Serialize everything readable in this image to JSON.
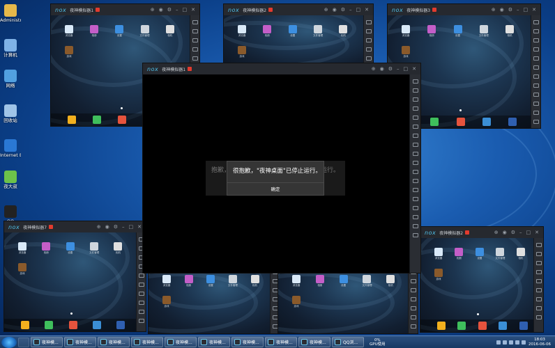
{
  "desktop": {
    "icons": [
      {
        "label": "Administr...",
        "icon": "user-folder-icon",
        "color": "#e6b84a"
      },
      {
        "label": "计算机",
        "icon": "computer-icon",
        "color": "#7fb2e6"
      },
      {
        "label": "网络",
        "icon": "network-icon",
        "color": "#52a0e0"
      },
      {
        "label": "回收站",
        "icon": "recycle-bin-icon",
        "color": "#9fc4e8"
      },
      {
        "label": "Internet Explorer",
        "icon": "internet-explorer-icon",
        "color": "#2a78d4"
      },
      {
        "label": "夜大叔",
        "icon": "app-icon",
        "color": "#6cc24a"
      },
      {
        "label": "QQ",
        "icon": "qq-penguin-icon",
        "color": "#222222"
      }
    ]
  },
  "windows": {
    "title_1": "夜神模拟器1",
    "title_2": "夜神模拟器2",
    "title_3": "夜神模拟器3",
    "title_7": "夜神模拟器7",
    "logo": "nox",
    "controls": [
      "⊕",
      "◉",
      "⚙",
      "–",
      "□",
      "✕"
    ]
  },
  "apps": {
    "top": [
      "浏览器",
      "相册",
      "设置",
      "文件管理",
      "相机"
    ],
    "games": "游戏",
    "dock": [
      "应用中心",
      "下载",
      "Google",
      "设置",
      "搜索"
    ]
  },
  "dialog": {
    "message": "很抱歉，\"夜神桌面\"已停止运行。",
    "ok_label": "确定",
    "ghost_left": "抱歉，",
    "ghost_right": "运行。"
  },
  "taskbar": {
    "items": [
      "夜神模...",
      "夜神模...",
      "夜神模...",
      "夜神模...",
      "夜神模...",
      "夜神模...",
      "夜神模...",
      "夜神模...",
      "夜神模...",
      "QQ浏..."
    ],
    "gpu_percent": "0%",
    "gpu_label": "GPU使用",
    "time": "18:03",
    "date": "2016-06-06"
  }
}
